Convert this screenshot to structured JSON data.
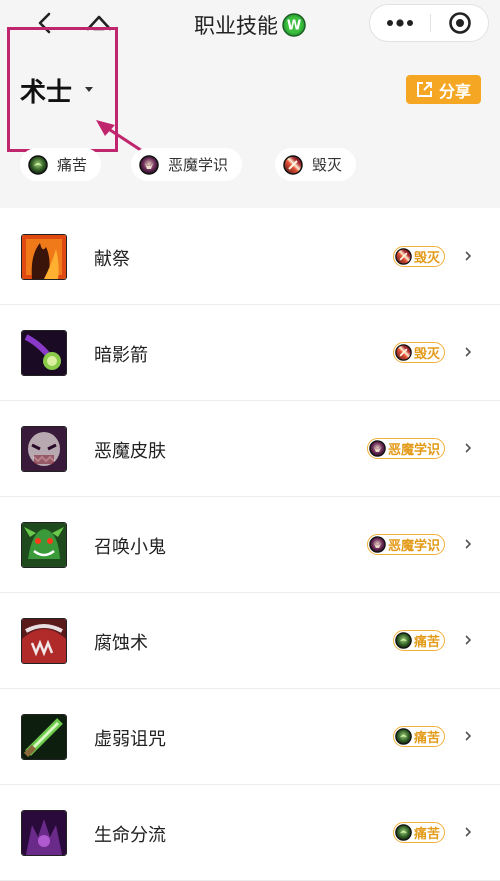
{
  "nav": {
    "title": "职业技能",
    "logo_letter": "W",
    "logo_color": "#2fa83a"
  },
  "class_selector": {
    "name": "术士"
  },
  "share": {
    "label": "分享",
    "color": "#f5a623"
  },
  "annotation": {
    "color": "#c0266d"
  },
  "specs": [
    {
      "label": "痛苦",
      "icon": "affliction-icon"
    },
    {
      "label": "恶魔学识",
      "icon": "demonology-icon"
    },
    {
      "label": "毁灭",
      "icon": "destruction-icon"
    }
  ],
  "skills": [
    {
      "name": "献祭",
      "spec": "毁灭",
      "icon": "immolate-icon",
      "spec_icon": "destruction-icon"
    },
    {
      "name": "暗影箭",
      "spec": "毁灭",
      "icon": "shadow-bolt-icon",
      "spec_icon": "destruction-icon"
    },
    {
      "name": "恶魔皮肤",
      "spec": "恶魔学识",
      "icon": "demon-skin-icon",
      "spec_icon": "demonology-icon"
    },
    {
      "name": "召唤小鬼",
      "spec": "恶魔学识",
      "icon": "summon-imp-icon",
      "spec_icon": "demonology-icon"
    },
    {
      "name": "腐蚀术",
      "spec": "痛苦",
      "icon": "corruption-icon",
      "spec_icon": "affliction-icon"
    },
    {
      "name": "虚弱诅咒",
      "spec": "痛苦",
      "icon": "curse-of-weakness-icon",
      "spec_icon": "affliction-icon"
    },
    {
      "name": "生命分流",
      "spec": "痛苦",
      "icon": "life-tap-icon",
      "spec_icon": "affliction-icon"
    }
  ]
}
